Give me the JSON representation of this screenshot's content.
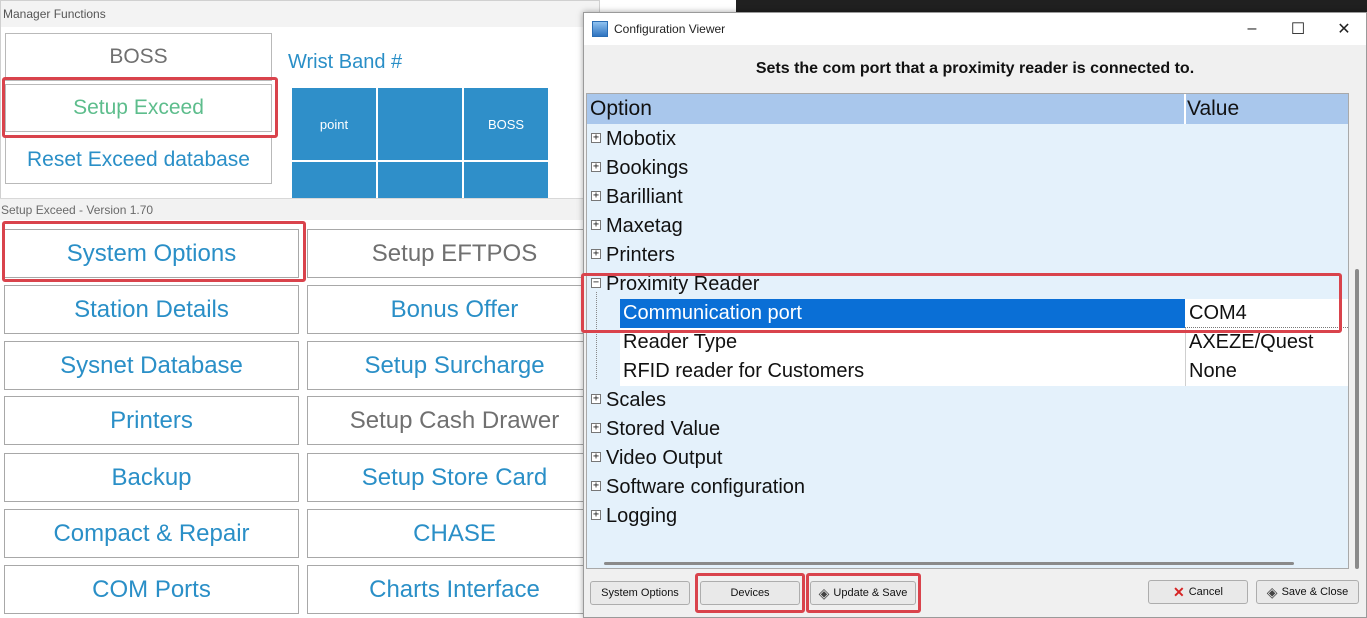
{
  "manager": {
    "title": "Manager Functions",
    "buttons": [
      "BOSS",
      "Setup Exceed",
      "Reset Exceed database"
    ],
    "wrist_title": "Wrist Band #",
    "tiles": [
      "point",
      "",
      "BOSS",
      "",
      "",
      ""
    ]
  },
  "setup": {
    "title": "Setup Exceed - Version 1.70",
    "left_buttons": [
      "System Options",
      "Station Details",
      "Sysnet Database",
      "Printers",
      "Backup",
      "Compact & Repair",
      "COM Ports"
    ],
    "right_buttons": [
      "Setup EFTPOS",
      "Bonus Offer",
      "Setup Surcharge",
      "Setup Cash Drawer",
      "Setup Store Card",
      "CHASE",
      "Charts Interface"
    ]
  },
  "config": {
    "title": "Configuration Viewer",
    "controls": {
      "minimize": "–",
      "maximize": "☐",
      "close": "✕"
    },
    "description": "Sets the com port that a proximity reader is connected to.",
    "columns": {
      "option": "Option",
      "value": "Value"
    },
    "rows": [
      {
        "label": "Mobotix",
        "state": "collapsed"
      },
      {
        "label": "Bookings",
        "state": "collapsed"
      },
      {
        "label": "Barilliant",
        "state": "collapsed"
      },
      {
        "label": "Maxetag",
        "state": "collapsed"
      },
      {
        "label": "Printers",
        "state": "collapsed"
      },
      {
        "label": "Proximity Reader",
        "state": "expanded"
      },
      {
        "label": "Communication port",
        "value": "COM4",
        "child": true,
        "selected": true
      },
      {
        "label": "Reader Type",
        "value": "AXEZE/Quest",
        "child": true
      },
      {
        "label": "RFID reader for Customers",
        "value": "None",
        "child": true
      },
      {
        "label": "Scales",
        "state": "collapsed"
      },
      {
        "label": "Stored Value",
        "state": "collapsed"
      },
      {
        "label": "Video Output",
        "state": "collapsed"
      },
      {
        "label": "Software configuration",
        "state": "collapsed"
      },
      {
        "label": "Logging",
        "state": "collapsed"
      }
    ],
    "buttons": {
      "system_options": "System Options",
      "devices": "Devices",
      "update_save": "Update & Save",
      "cancel": "Cancel",
      "save_close": "Save & Close"
    }
  },
  "colors": {
    "accent": "#2a8fc7",
    "highlight": "#d9434c",
    "selection": "#0a6fd6",
    "header": "#a9c7ec"
  }
}
